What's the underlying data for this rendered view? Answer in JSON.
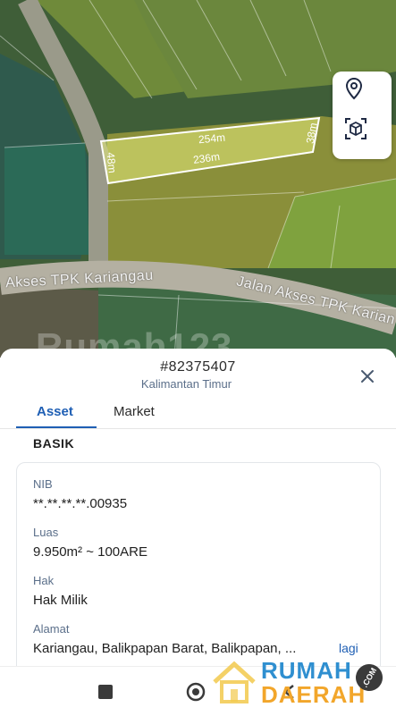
{
  "map": {
    "road_label_left": "Akses TPK Kariangau",
    "road_label_right": "Jalan Akses TPK Karian",
    "dimensions": {
      "top": "254m",
      "bottom": "236m",
      "left": "48m",
      "right": "38m"
    },
    "watermark": "Rumah123",
    "parcel_color": "#e6ec7a",
    "controls": [
      {
        "name": "location-pin",
        "icon": "map-pin-icon"
      },
      {
        "name": "3d-view",
        "icon": "cube-scan-icon"
      }
    ]
  },
  "sheet": {
    "listing_id": "#82375407",
    "region": "Kalimantan Timur",
    "tabs": [
      {
        "label": "Asset",
        "active": true
      },
      {
        "label": "Market",
        "active": false
      }
    ],
    "section_title": "BASIK",
    "fields": [
      {
        "label": "NIB",
        "value": "**.**.**.**.00935"
      },
      {
        "label": "Luas",
        "value": "9.950m² ~ 100ARE"
      },
      {
        "label": "Hak",
        "value": "Hak Milik"
      },
      {
        "label": "Alamat",
        "value": "Kariangau, Balikpapan Barat, Balikpapan, ...",
        "more": "lagi"
      }
    ],
    "accent_color": "#1f5fb4"
  },
  "navbar": {
    "items": [
      "recent-apps-icon",
      "home-icon",
      "back-icon"
    ]
  },
  "brand": {
    "line1": "RUMAH",
    "line2": "DAERAH",
    "badge": ".COM"
  }
}
